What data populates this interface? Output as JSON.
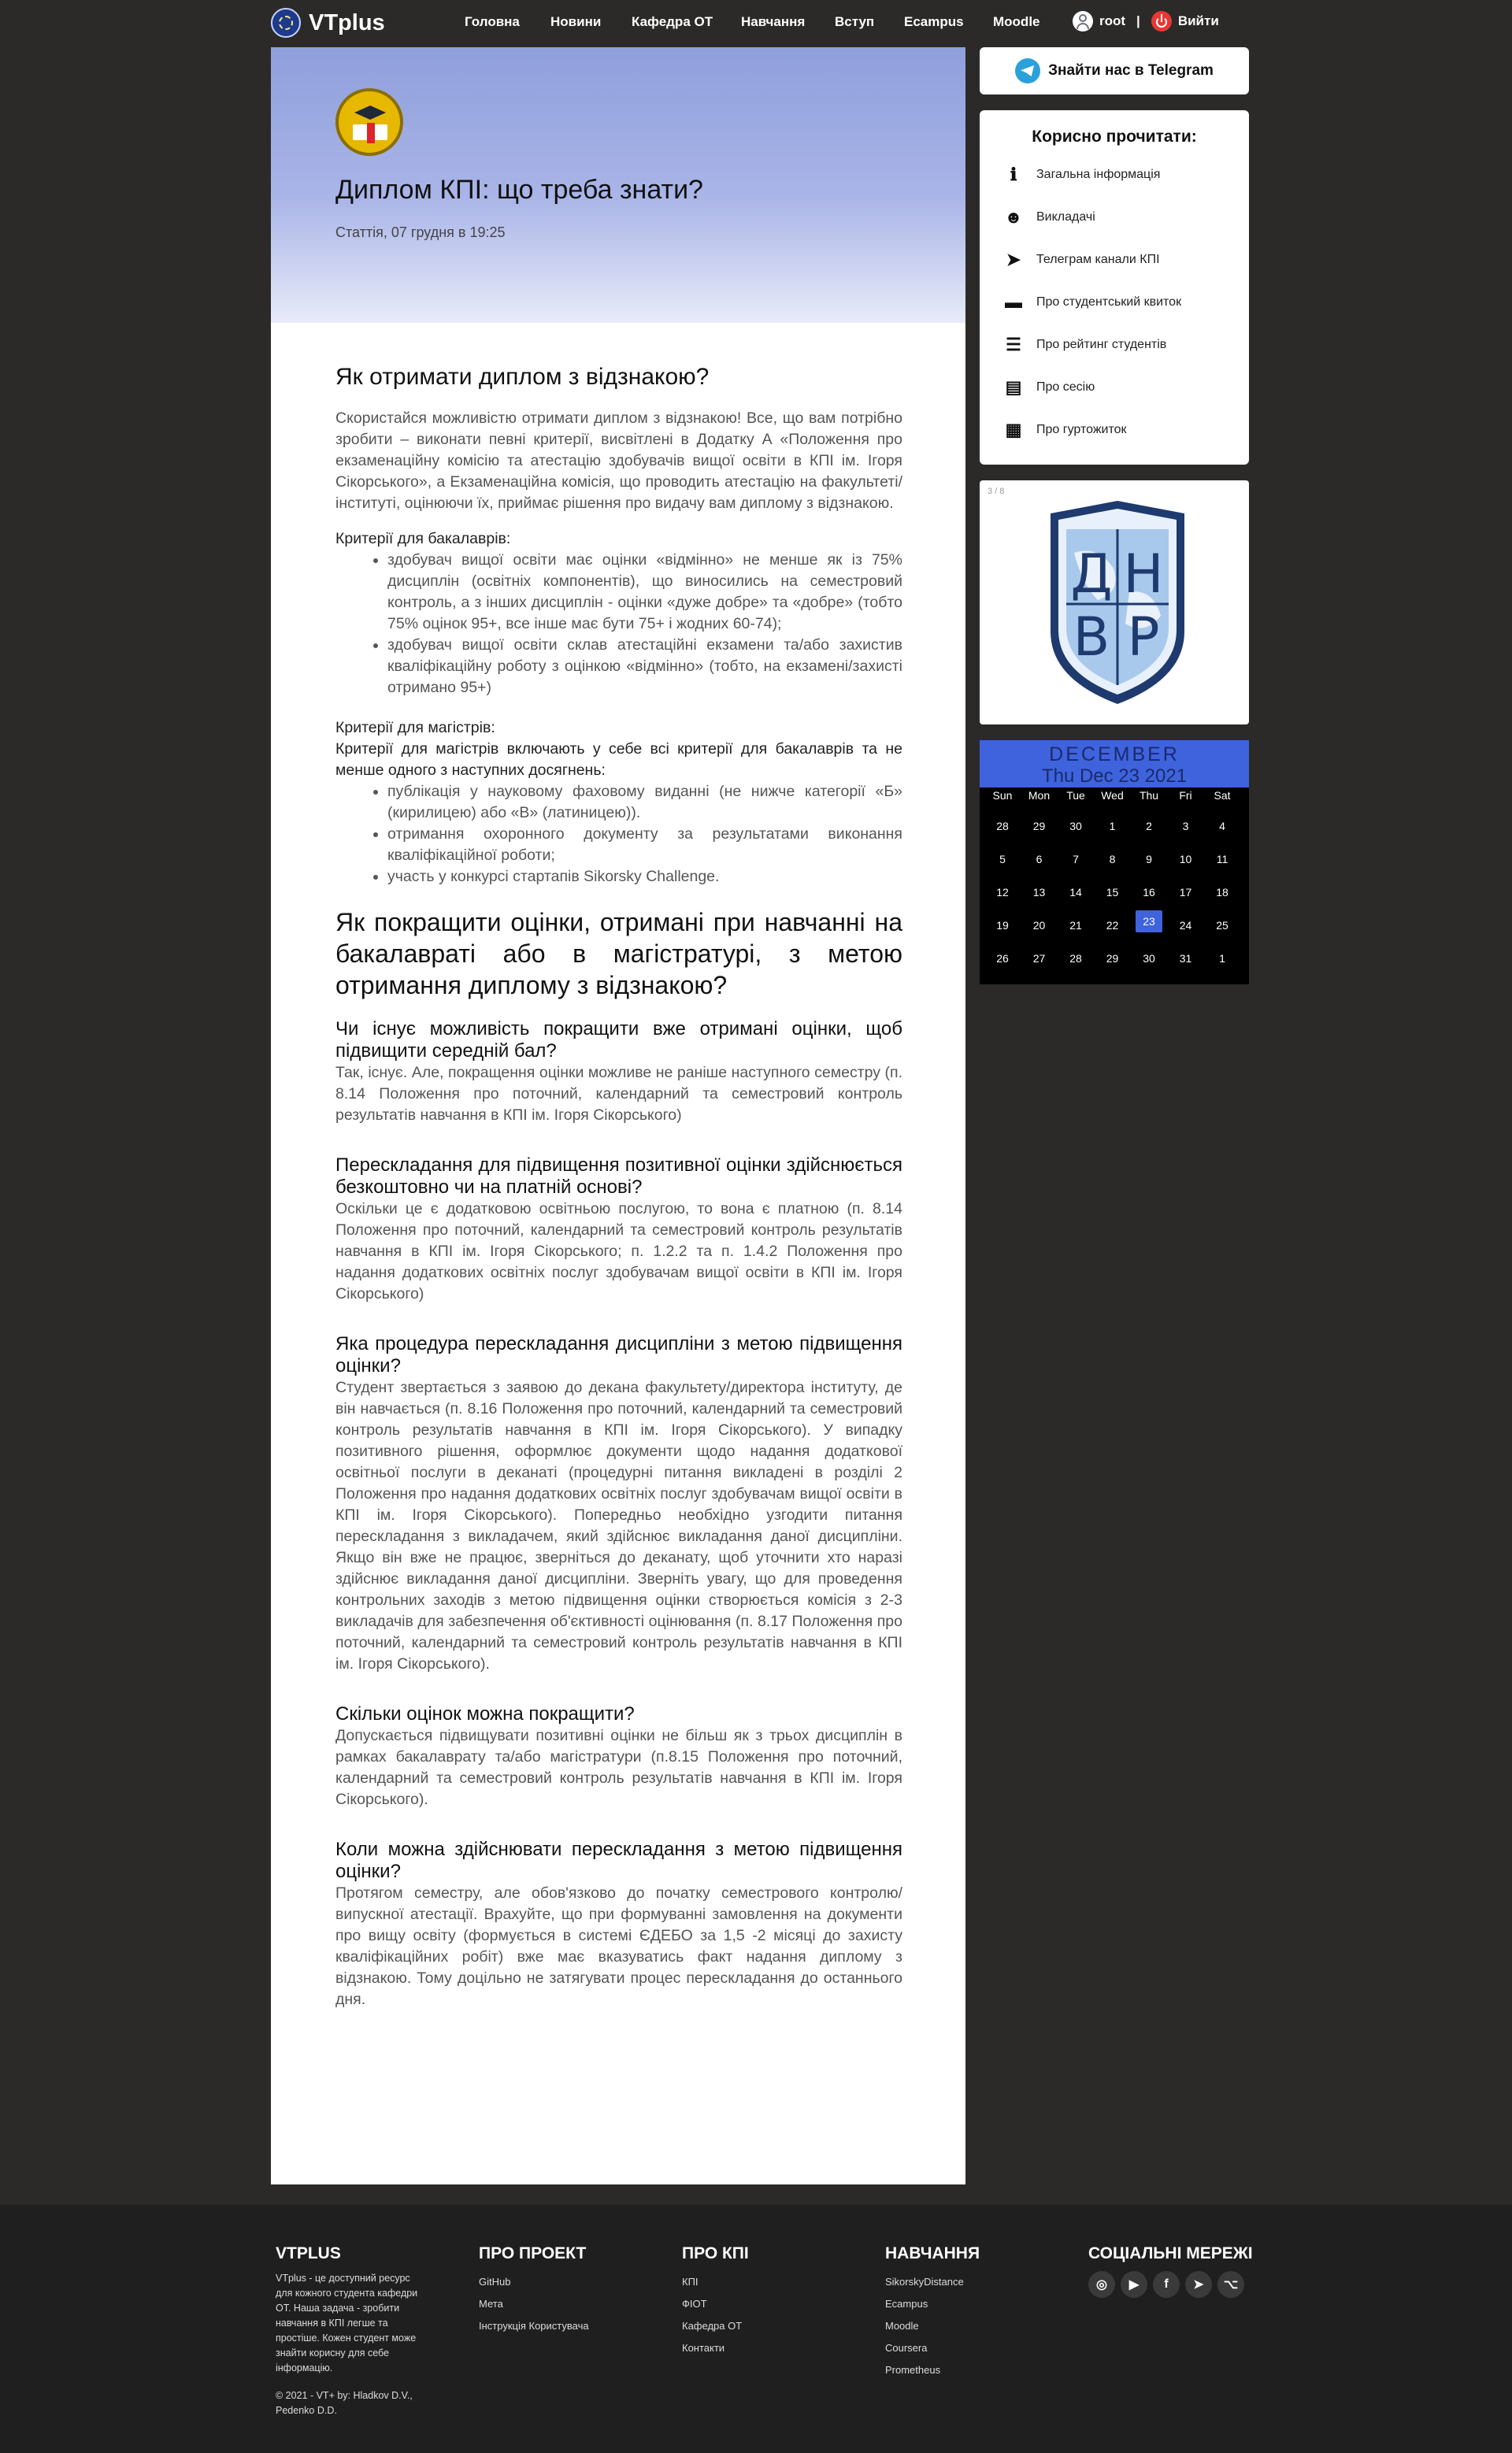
{
  "nav": {
    "brand": "VTplus",
    "links": [
      "Головна",
      "Новини",
      "Кафедра ОТ",
      "Навчання",
      "Вступ",
      "Ecampus",
      "Moodle"
    ],
    "user": "root",
    "separator": "|",
    "logout": "Вийти"
  },
  "article": {
    "title": "Диплом КПІ: що треба знати?",
    "meta": "Статтія, 07 грудня в 19:25",
    "h_honors": "Як отримати диплом з відзнакою?",
    "intro": "Скористайся можливістю отримати диплом з відзнакою! Все, що вам потрібно зробити – виконати певні критерії, висвітлені в Додатку А «Положення про екзаменаційну комісію та атестацію здобувачів вищої освіти в КПІ ім. Ігоря Сікорського», а Екзаменаційна комісія, що проводить атестацію на факультеті/інституті, оцінюючи їх, приймає рішення про видачу вам диплому з відзнакою.",
    "bachelor_title": "Критерії для бакалаврів:",
    "bachelor_items": [
      "здобувач вищої освіти має оцінки «відмінно» не менше як із 75% дисциплін (освітніх компонентів), що виносились на семестровий контроль, а з інших дисциплін - оцінки «дуже добре» та «добре» (тобто 75% оцінок 95+, все інше має бути 75+ і жодних 60-74);",
      "здобувач вищої освіти склав атестаційні екзамени та/або захистив кваліфікаційну роботу з оцінкою «відмінно» (тобто, на екзамені/захисті отримано 95+)"
    ],
    "master_title": "Критерії для магістрів:",
    "master_intro": "Критерії для магістрів включають у себе всі критерії для бакалаврів та не менше одного з наступних досягнень:",
    "master_items": [
      "публікація у науковому фаховому виданні (не нижче категорії «Б» (кирилицею) або «В» (латиницею)).",
      "отримання охоронного документу за результатами виконання кваліфікаційної роботи;",
      "участь у конкурсі стартапів Sikorsky Challenge."
    ],
    "h_improve": "Як покращити оцінки, отримані при навчанні на бакалавраті або в магістратурі, з метою отримання диплому з відзнакою?",
    "qa": [
      {
        "q": "Чи існує можливість покращити вже отримані оцінки, щоб підвищити середній бал?",
        "a": "Так, існує. Але, покращення оцінки можливе не раніше наступного семестру (п. 8.14 Положення про поточний, календарний та семестровий контроль результатів навчання в КПІ ім. Ігоря Сікорського)"
      },
      {
        "q": "Перескладання для підвищення позитивної оцінки здійснюється безкоштовно чи на платній основі?",
        "a": "Оскільки це є додатковою освітньою послугою, то вона є платною (п. 8.14 Положення про поточний, календарний та семестровий контроль результатів навчання в КПІ ім. Ігоря Сікорського; п. 1.2.2 та п. 1.4.2 Положення про надання додаткових освітніх послуг здобувачам вищої освіти в КПІ ім. Ігоря Сікорського)"
      },
      {
        "q": "Яка процедура перескладання дисципліни з метою підвищення оцінки?",
        "a": "Студент звертається з заявою до декана факультету/директора інституту, де він навчається (п. 8.16 Положення про поточний, календарний та семестровий контроль результатів навчання в КПІ ім. Ігоря Сікорського). У випадку позитивного рішення, оформлює документи щодо надання додаткової освітньої послуги в деканаті (процедурні питання викладені в розділі 2 Положення про надання додаткових освітніх послуг здобувачам вищої освіти в КПІ ім. Ігоря Сікорського). Попередньо необхідно узгодити питання перескладання з викладачем, який здійснює викладання даної дисципліни. Якщо він вже не працює, зверніться до деканату, щоб уточнити хто наразі здійснює викладання даної дисципліни. Зверніть увагу, що для проведення контрольних заходів з метою підвищення оцінки створюється комісія з 2-3 викладачів для забезпечення об'єктивності оцінювання (п. 8.17 Положення про поточний, календарний та семестровий контроль результатів навчання в КПІ ім. Ігоря Сікорського)."
      },
      {
        "q": "Скільки оцінок можна покращити?",
        "a": "Допускається підвищувати позитивні оцінки не більш як з трьох дисциплін в рамках бакалаврату та/або магістратури (п.8.15 Положення про поточний, календарний та семестровий контроль результатів навчання в КПІ ім. Ігоря Сікорського)."
      },
      {
        "q": "Коли можна здійснювати перескладання з метою підвищення оцінки?",
        "a": "Протягом семестру, але обов'язково до початку семестрового контролю/випускної атестації. Врахуйте, що при формуванні замовлення на документи про вищу освіту (формується в системі ЄДЕБО за 1,5 -2 місяці до захисту кваліфікаційних робіт) вже має вказуватись факт надання диплому з відзнакою. Тому доцільно не затягувати процес перескладання до останнього дня."
      }
    ]
  },
  "sidebar": {
    "telegram_button": "Знайти нас в Telegram",
    "read_title": "Корисно прочитати:",
    "read_items": [
      {
        "label": "Загальна інформація",
        "icon": "info-icon"
      },
      {
        "label": "Викладачі",
        "icon": "teacher-icon"
      },
      {
        "label": "Телеграм канали КПІ",
        "icon": "paper-plane-icon"
      },
      {
        "label": "Про студентський квиток",
        "icon": "id-card-icon"
      },
      {
        "label": "Про рейтинг студентів",
        "icon": "list-icon"
      },
      {
        "label": "Про сесію",
        "icon": "grade-file-icon"
      },
      {
        "label": "Про гуртожиток",
        "icon": "building-icon"
      }
    ],
    "slider_counter": "3 / 8",
    "slider_image_letters": [
      "Д",
      "Н",
      "В",
      "Р"
    ]
  },
  "calendar": {
    "month": "DECEMBER",
    "date": "Thu Dec 23 2021",
    "weekdays": [
      "Sun",
      "Mon",
      "Tue",
      "Wed",
      "Thu",
      "Fri",
      "Sat"
    ],
    "weeks": [
      [
        "28",
        "29",
        "30",
        "1",
        "2",
        "3",
        "4"
      ],
      [
        "5",
        "6",
        "7",
        "8",
        "9",
        "10",
        "11"
      ],
      [
        "12",
        "13",
        "14",
        "15",
        "16",
        "17",
        "18"
      ],
      [
        "19",
        "20",
        "21",
        "22",
        "23",
        "24",
        "25"
      ],
      [
        "26",
        "27",
        "28",
        "29",
        "30",
        "31",
        "1"
      ]
    ],
    "today": "23",
    "accent": "#3e63dd"
  },
  "footer": {
    "about_title": "VTPLUS",
    "about_text": "VTplus - це доступний ресурс для кожного студента кафедри ОТ. Наша задача - зробити навчання в КПІ легше та простіше. Кожен студент може знайти корисну для себе інформацію.",
    "copyright": "© 2021 - VT+ by: Hladkov D.V., Pedenko D.D.",
    "project_title": "ПРО ПРОЕКТ",
    "project_links": [
      "GitHub",
      "Мета",
      "Інструкція Користувача"
    ],
    "kpi_title": "ПРО КПІ",
    "kpi_links": [
      "КПІ",
      "ФІОТ",
      "Кафедра ОТ",
      "Контакти"
    ],
    "study_title": "НАВЧАННЯ",
    "study_links": [
      "SikorskyDistance",
      "Ecampus",
      "Moodle",
      "Coursera",
      "Prometheus"
    ],
    "social_title": "СОЦІАЛЬНІ МЕРЕЖІ",
    "social_icons": [
      "instagram-icon",
      "youtube-icon",
      "facebook-icon",
      "telegram-icon",
      "github-icon"
    ]
  }
}
